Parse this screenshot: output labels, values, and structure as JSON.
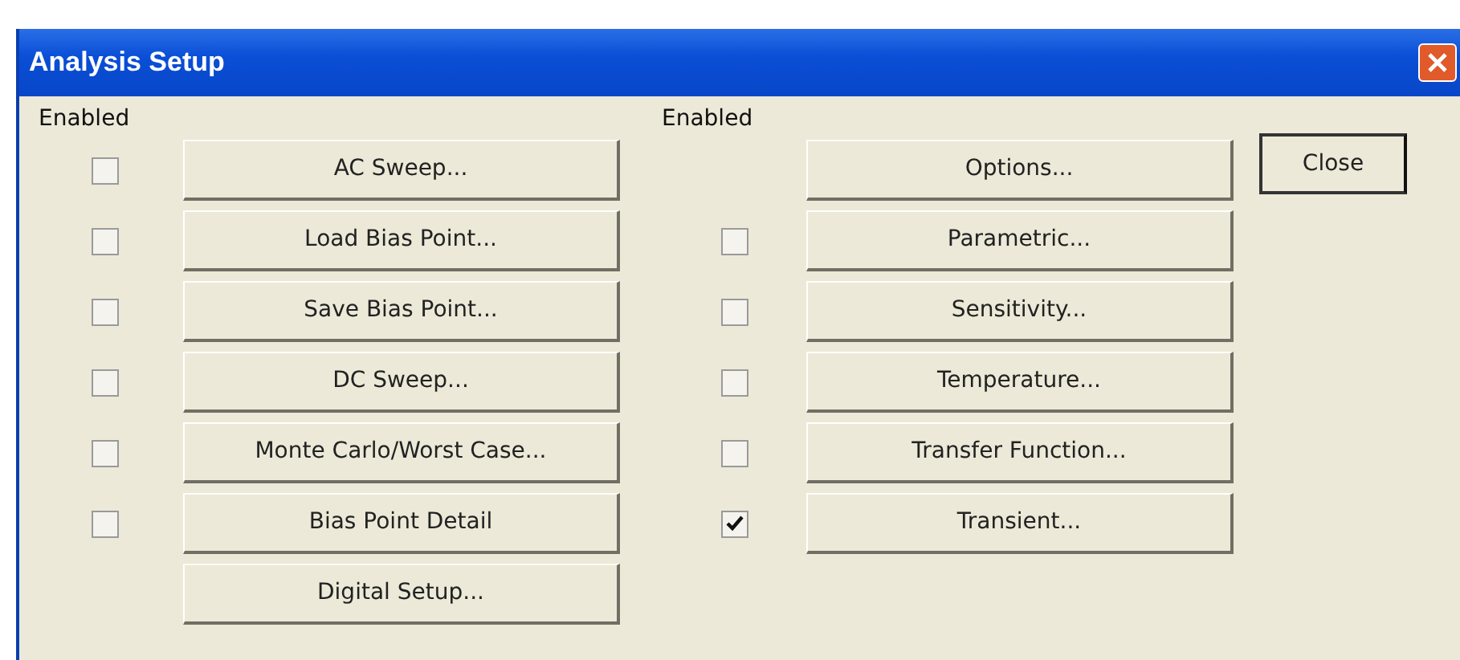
{
  "window": {
    "title": "Analysis Setup"
  },
  "left": {
    "heading": "Enabled",
    "items": [
      {
        "kind": "checkbox-row",
        "label": "AC Sweep...",
        "checked": false
      },
      {
        "kind": "checkbox-row",
        "label": "Load Bias Point...",
        "checked": false
      },
      {
        "kind": "checkbox-row",
        "label": "Save Bias Point...",
        "checked": false
      },
      {
        "kind": "checkbox-row",
        "label": "DC Sweep...",
        "checked": false
      },
      {
        "kind": "checkbox-row",
        "label": "Monte Carlo/Worst Case...",
        "checked": false
      },
      {
        "kind": "checkbox-row",
        "label": "Bias Point Detail",
        "checked": false
      },
      {
        "kind": "button-only",
        "label": "Digital Setup..."
      }
    ]
  },
  "right": {
    "heading": "Enabled",
    "items": [
      {
        "kind": "button-only",
        "label": "Options..."
      },
      {
        "kind": "checkbox-row",
        "label": "Parametric...",
        "checked": false
      },
      {
        "kind": "checkbox-row",
        "label": "Sensitivity...",
        "checked": false
      },
      {
        "kind": "checkbox-row",
        "label": "Temperature...",
        "checked": false
      },
      {
        "kind": "checkbox-row",
        "label": "Transfer Function...",
        "checked": false
      },
      {
        "kind": "checkbox-row",
        "label": "Transient...",
        "checked": true
      }
    ]
  },
  "buttons": [
    "Close"
  ]
}
